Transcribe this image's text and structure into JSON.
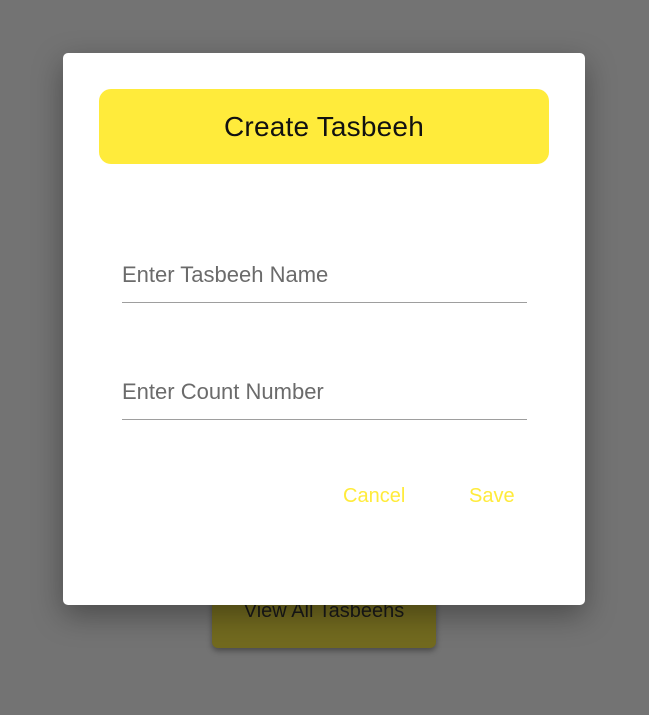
{
  "background": {
    "view_all_button_label": "View All Tasbeehs"
  },
  "dialog": {
    "title": "Create Tasbeeh",
    "name_field": {
      "placeholder": "Enter Tasbeeh Name",
      "value": ""
    },
    "count_field": {
      "placeholder": "Enter Count Number",
      "value": ""
    },
    "cancel_label": "Cancel",
    "save_label": "Save"
  },
  "colors": {
    "accent": "#ffeb3b",
    "scrim": "#737373",
    "surface": "#ffffff"
  }
}
